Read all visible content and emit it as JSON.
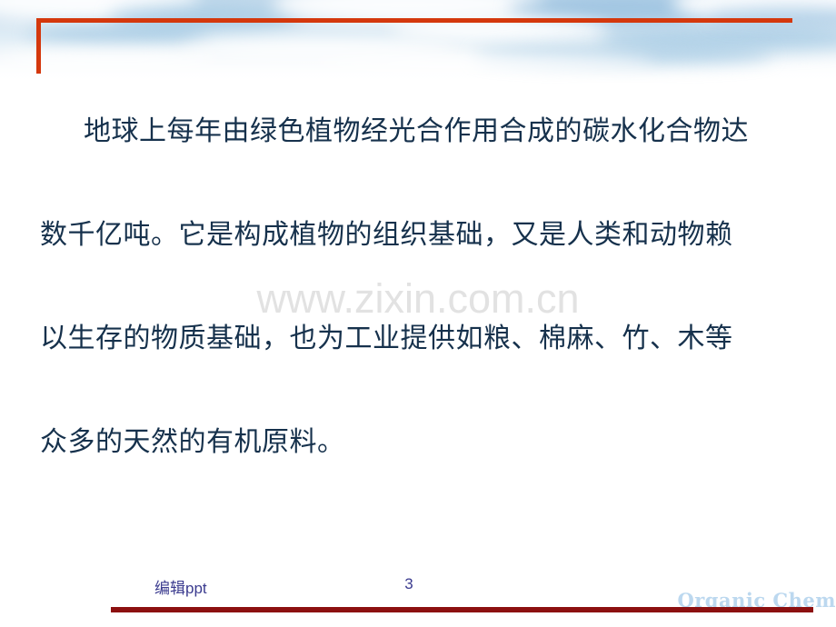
{
  "slide": {
    "background_color": "#ffffff",
    "banner": {
      "name": "sky-clouds-banner",
      "colors": [
        "#c6dced",
        "#d3e4f1",
        "#e9f2f8",
        "#ffffff"
      ]
    },
    "accent_bracket_color": "#d4380d",
    "body": {
      "text_color": "#16314c",
      "lines": [
        "地球上每年由绿色植物经光合作用合成的碳水化合物达",
        "数千亿吨。它是构成植物的组织基础，又是人类和动物赖",
        "以生存的物质基础，也为工业提供如粮、棉麻、竹、木等",
        "众多的天然的有机原料。"
      ]
    },
    "watermark": {
      "text": "www.zixin.com.cn",
      "color": "#e2e2e2"
    },
    "footer": {
      "editor_label": "编辑ppt",
      "page_number": "3",
      "brand": "Organic Chem",
      "brand_color": "#bcd8ef",
      "rule_color": "#8c1010",
      "text_color": "#3b3b8f"
    }
  }
}
